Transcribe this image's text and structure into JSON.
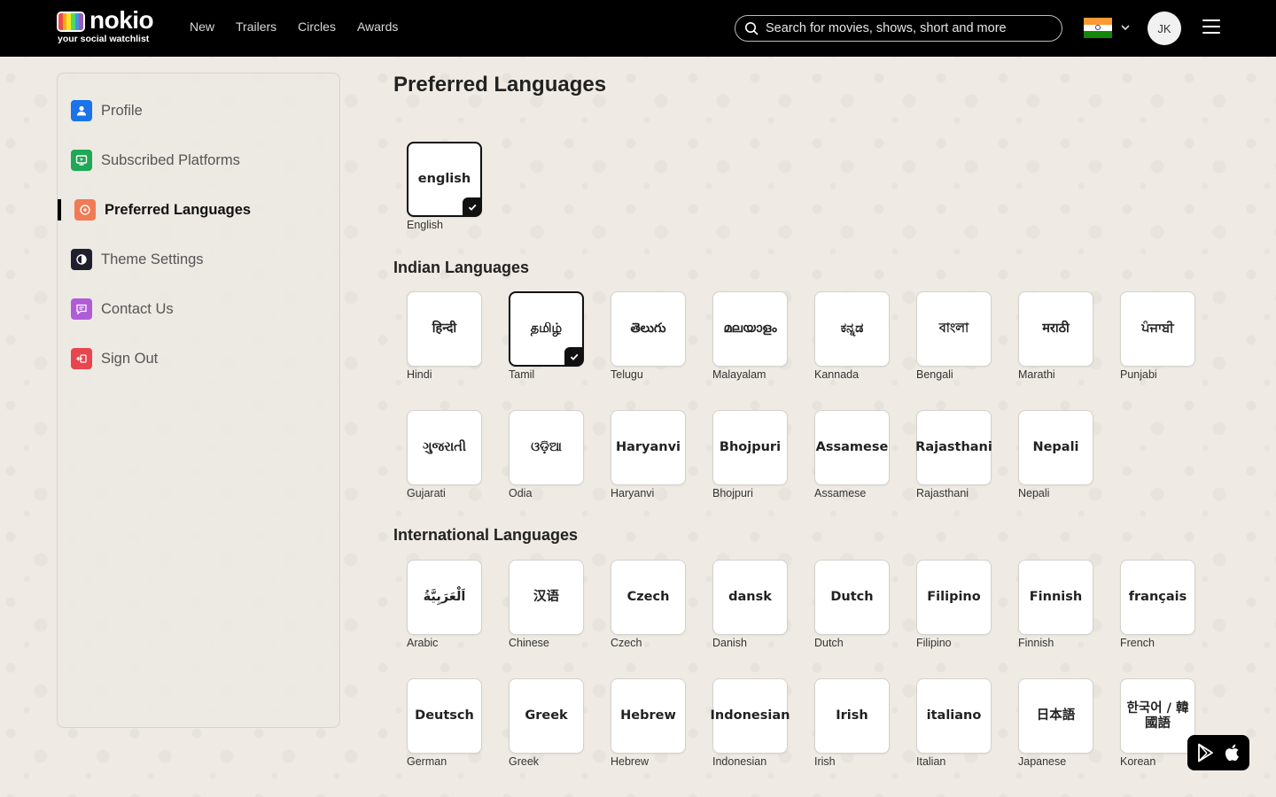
{
  "header": {
    "logo": {
      "name": "nokio",
      "tagline": "your social watchlist"
    },
    "nav": [
      "New",
      "Trailers",
      "Circles",
      "Awards"
    ],
    "search_placeholder": "Search for movies, shows, short and more",
    "avatar_initials": "JK"
  },
  "sidebar": {
    "items": [
      {
        "label": "Profile",
        "icon": "user-icon",
        "color": "#1a73e8"
      },
      {
        "label": "Subscribed Platforms",
        "icon": "tv-play-icon",
        "color": "#1fa855"
      },
      {
        "label": "Preferred Languages",
        "icon": "language-icon",
        "color": "#f27a54",
        "active": true
      },
      {
        "label": "Theme Settings",
        "icon": "theme-icon",
        "color": "#1f1f2e"
      },
      {
        "label": "Contact Us",
        "icon": "message-icon",
        "color": "#b05bd8"
      },
      {
        "label": "Sign Out",
        "icon": "sign-out-icon",
        "color": "#e8454f"
      }
    ]
  },
  "main": {
    "title": "Preferred Languages",
    "primary": [
      {
        "native": "english",
        "name": "English",
        "selected": true
      }
    ],
    "indian_title": "Indian Languages",
    "indian": [
      {
        "native": "हिन्दी",
        "name": "Hindi"
      },
      {
        "native": "தமிழ்",
        "name": "Tamil",
        "selected": true
      },
      {
        "native": "తెలుగు",
        "name": "Telugu"
      },
      {
        "native": "മലയാളം",
        "name": "Malayalam"
      },
      {
        "native": "ಕನ್ನಡ",
        "name": "Kannada"
      },
      {
        "native": "বাংলা",
        "name": "Bengali"
      },
      {
        "native": "मराठी",
        "name": "Marathi"
      },
      {
        "native": "ਪੰਜਾਬੀ",
        "name": "Punjabi"
      },
      {
        "native": "ગુજરાતી",
        "name": "Gujarati"
      },
      {
        "native": "ଓଡ଼ିଆ",
        "name": "Odia"
      },
      {
        "native": "Haryanvi",
        "name": "Haryanvi"
      },
      {
        "native": "Bhojpuri",
        "name": "Bhojpuri"
      },
      {
        "native": "Assamese",
        "name": "Assamese"
      },
      {
        "native": "Rajasthani",
        "name": "Rajasthani"
      },
      {
        "native": "Nepali",
        "name": "Nepali"
      }
    ],
    "international_title": "International Languages",
    "international": [
      {
        "native": "اَلْعَرَبِيَّةُ",
        "name": "Arabic"
      },
      {
        "native": "汉语",
        "name": "Chinese"
      },
      {
        "native": "Czech",
        "name": "Czech"
      },
      {
        "native": "dansk",
        "name": "Danish"
      },
      {
        "native": "Dutch",
        "name": "Dutch"
      },
      {
        "native": "Filipino",
        "name": "Filipino"
      },
      {
        "native": "Finnish",
        "name": "Finnish"
      },
      {
        "native": "français",
        "name": "French"
      },
      {
        "native": "Deutsch",
        "name": "German"
      },
      {
        "native": "Greek",
        "name": "Greek"
      },
      {
        "native": "Hebrew",
        "name": "Hebrew"
      },
      {
        "native": "Indonesian",
        "name": "Indonesian"
      },
      {
        "native": "Irish",
        "name": "Irish"
      },
      {
        "native": "italiano",
        "name": "Italian"
      },
      {
        "native": "日本語",
        "name": "Japanese"
      },
      {
        "native": "한국어 / 韓國語",
        "name": "Korean"
      }
    ]
  },
  "colors": {
    "header_bg": "#000000",
    "page_bg": "#efebe4",
    "selected_border": "#111111",
    "flag_saffron": "#ff9933",
    "flag_white": "#ffffff",
    "flag_green": "#138808"
  }
}
